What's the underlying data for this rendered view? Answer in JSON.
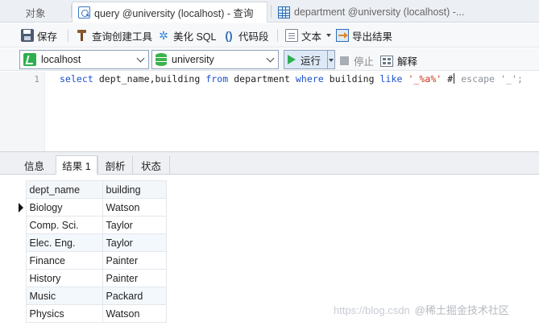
{
  "tabs": {
    "objects": "对象",
    "query": "query @university (localhost) - 查询",
    "department": "department @university (localhost) -..."
  },
  "toolbar": {
    "save": "保存",
    "query_builder": "查询创建工具",
    "beautify_sql": "美化 SQL",
    "snippet": "代码段",
    "text": "文本",
    "export_result": "导出结果"
  },
  "connection": {
    "connection_value": "localhost",
    "database_value": "university",
    "run": "运行",
    "stop": "停止",
    "explain": "解释"
  },
  "editor": {
    "line_number": "1",
    "sql_tokens": {
      "kw_select": "select",
      "cols": " dept_name,building ",
      "kw_from": "from",
      "table": " department ",
      "kw_where": "where",
      "col": " building ",
      "kw_like": "like",
      "literal": "'_%a%'",
      "comment_pre": " #",
      "comment_post": " escape '_';"
    }
  },
  "result_tabs": [
    "信息",
    "结果 1",
    "剖析",
    "状态"
  ],
  "result_grid": {
    "columns": [
      "dept_name",
      "building"
    ],
    "rows": [
      [
        "Biology",
        "Watson"
      ],
      [
        "Comp. Sci.",
        "Taylor"
      ],
      [
        "Elec. Eng.",
        "Taylor"
      ],
      [
        "Finance",
        "Painter"
      ],
      [
        "History",
        "Painter"
      ],
      [
        "Music",
        "Packard"
      ],
      [
        "Physics",
        "Watson"
      ]
    ]
  },
  "watermark": {
    "url": "https://blog.csdn",
    "brand": "@稀土掘金技术社区"
  },
  "colors": {
    "keyword": "#1b4fcf",
    "string": "#c8321a",
    "run_green": "#2fae4f"
  }
}
